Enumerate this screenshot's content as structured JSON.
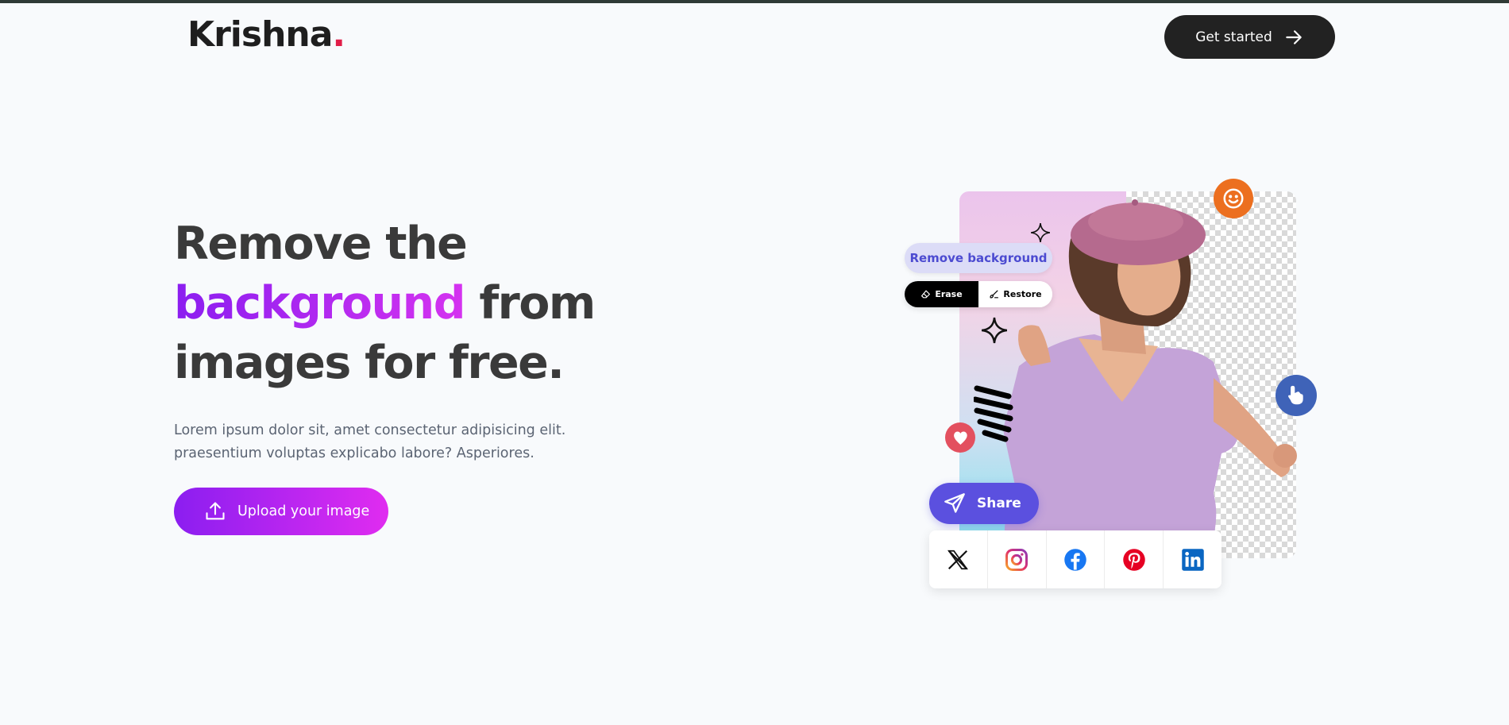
{
  "header": {
    "logo_text": "Krishna",
    "logo_dot": ".",
    "cta_label": "Get started"
  },
  "hero": {
    "title_line1": "Remove the",
    "title_highlight": "background",
    "title_after_highlight": " from",
    "title_line3": "images for free.",
    "subtitle_line1": "Lorem ipsum dolor sit, amet consectetur adipisicing elit.",
    "subtitle_line2": "praesentium voluptas explicabo labore? Asperiores.",
    "upload_label": "Upload your image"
  },
  "illustration": {
    "remove_bg_label": "Remove background",
    "erase_label": "Erase",
    "restore_label": "Restore",
    "share_label": "Share",
    "social_icons": [
      "x-icon",
      "instagram-icon",
      "facebook-icon",
      "pinterest-icon",
      "linkedin-icon"
    ]
  },
  "colors": {
    "accent_start": "#8b1ef0",
    "accent_end": "#e02cf0",
    "dark": "#222222",
    "share": "#5b50df",
    "logo_dot": "#e11d48"
  }
}
